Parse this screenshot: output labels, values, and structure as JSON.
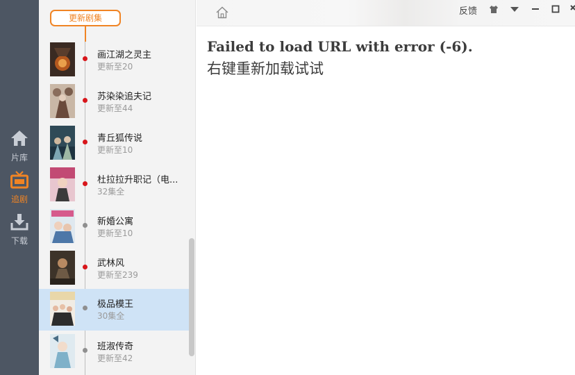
{
  "nav": {
    "items": [
      {
        "label": "片库",
        "icon": "home-icon",
        "active": false
      },
      {
        "label": "追剧",
        "icon": "tv-icon",
        "active": true
      },
      {
        "label": "下载",
        "icon": "download-icon",
        "active": false
      }
    ]
  },
  "sidebar": {
    "header_label": "更新剧集",
    "items": [
      {
        "title": "画江湖之灵主",
        "status": "更新至20",
        "new": true
      },
      {
        "title": "苏染染追夫记",
        "status": "更新至44",
        "new": true
      },
      {
        "title": "青丘狐传说",
        "status": "更新至10",
        "new": true
      },
      {
        "title": "杜拉拉升职记（电...",
        "status": "32集全",
        "new": true
      },
      {
        "title": "新婚公寓",
        "status": "更新至10",
        "new": false
      },
      {
        "title": "武林风",
        "status": "更新至239",
        "new": true
      },
      {
        "title": "极品模王",
        "status": "30集全",
        "new": false,
        "selected": true
      },
      {
        "title": "班淑传奇",
        "status": "更新至42",
        "new": false
      }
    ]
  },
  "toolbar": {
    "feedback_label": "反馈",
    "home_icon": "home-outline-icon",
    "skin_icon": "shirt-icon",
    "menu_icon": "dropdown-arrow-icon",
    "min_icon": "minimize-icon",
    "max_icon": "maximize-icon",
    "close_icon": "close-icon"
  },
  "main": {
    "error_line1": "Failed to load URL with error (-6).",
    "error_line2": "右键重新加载试试"
  },
  "colors": {
    "accent": "#f08424",
    "new_dot": "#d8161b",
    "rail_bg": "#4d5663",
    "selected_row": "#cfe3f6"
  }
}
